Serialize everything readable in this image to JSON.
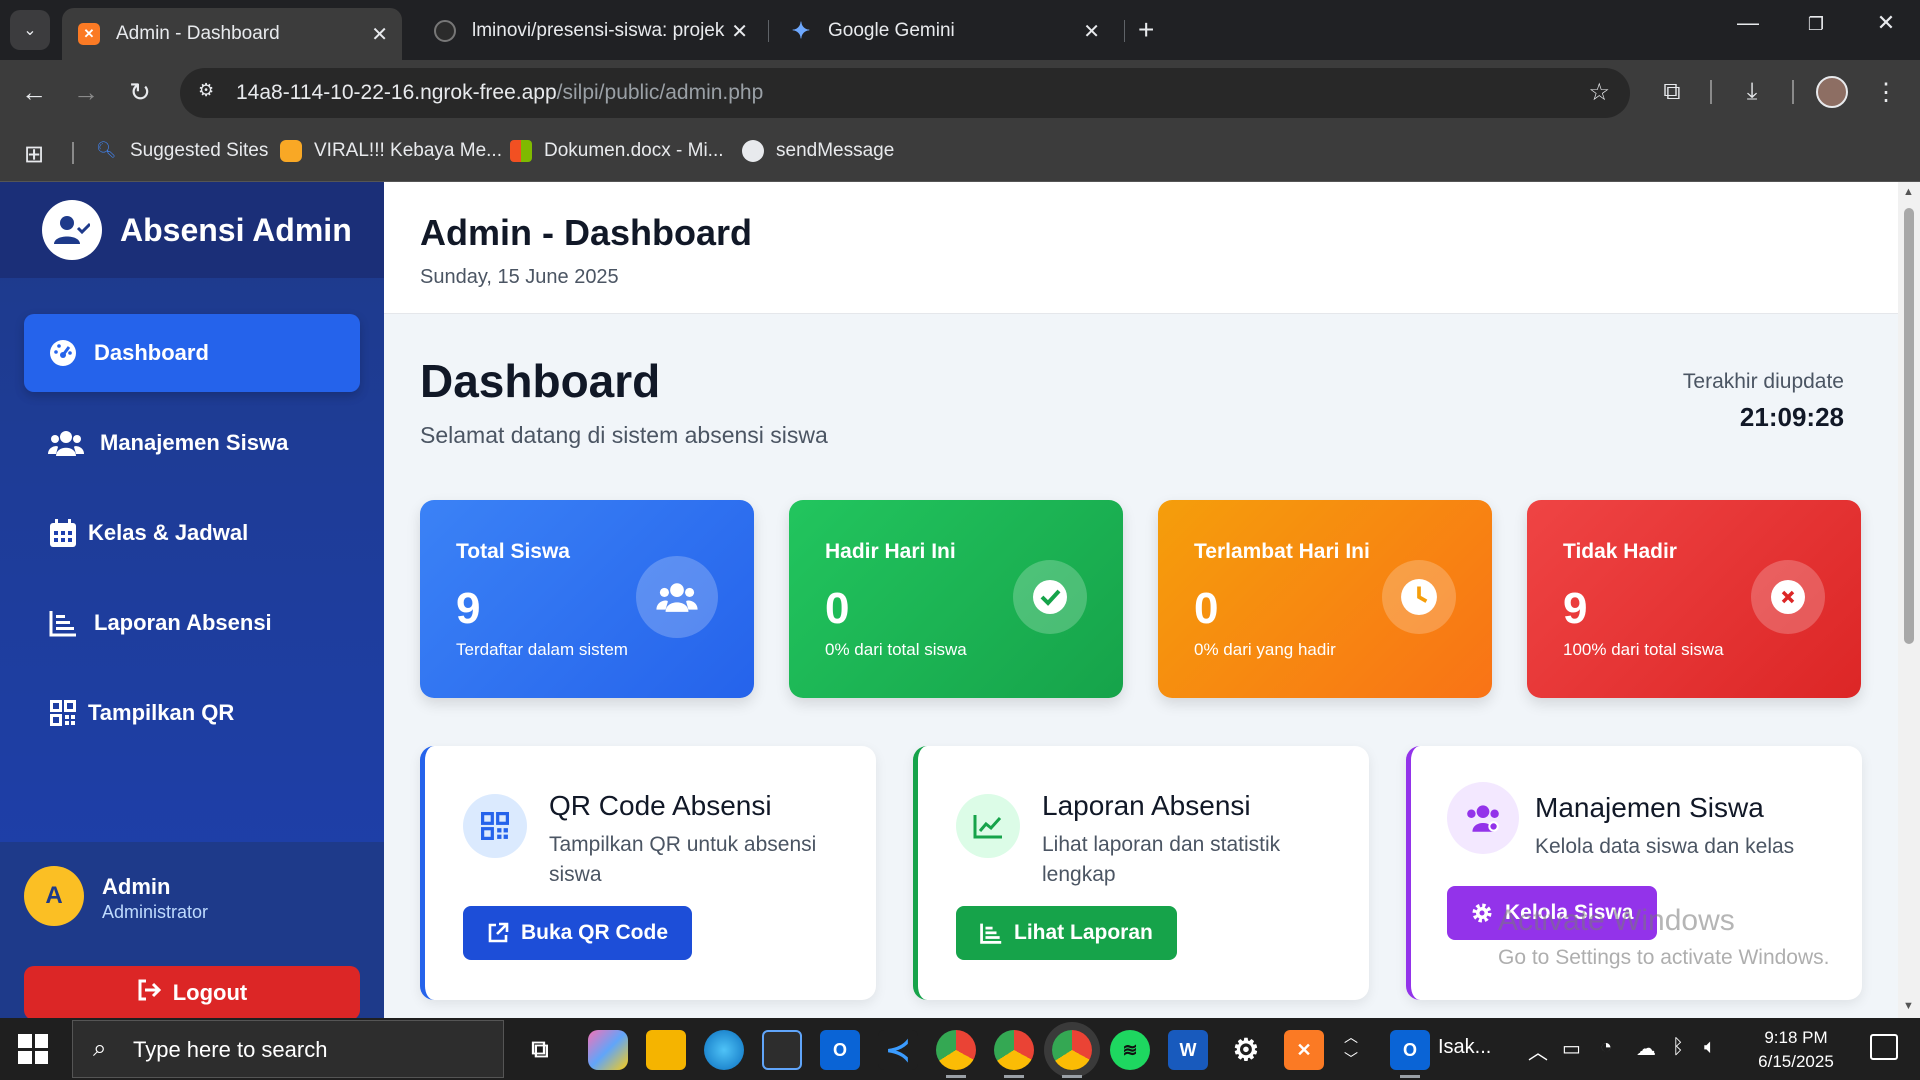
{
  "browser": {
    "tabs": [
      {
        "title": "Admin - Dashboard",
        "active": true
      },
      {
        "title": "lminovi/presensi-siswa: projek p",
        "active": false
      },
      {
        "title": "Google Gemini",
        "active": false
      }
    ],
    "url_host": "14a8-114-10-22-16.ngrok-free.app",
    "url_path": "/silpi/public/admin.php",
    "bookmarks": [
      "Suggested Sites",
      "VIRAL!!! Kebaya Me...",
      "Dokumen.docx - Mi...",
      "sendMessage"
    ]
  },
  "sidebar": {
    "brand": "Absensi Admin",
    "items": [
      {
        "label": "Dashboard",
        "icon": "gauge-icon",
        "active": true
      },
      {
        "label": "Manajemen Siswa",
        "icon": "users-icon",
        "active": false
      },
      {
        "label": "Kelas & Jadwal",
        "icon": "calendar-icon",
        "active": false
      },
      {
        "label": "Laporan Absensi",
        "icon": "chart-icon",
        "active": false
      },
      {
        "label": "Tampilkan QR",
        "icon": "qr-icon",
        "active": false
      }
    ],
    "user": {
      "initial": "A",
      "name": "Admin",
      "role": "Administrator"
    },
    "logout_label": "Logout"
  },
  "header": {
    "title": "Admin - Dashboard",
    "date": "Sunday, 15 June 2025"
  },
  "dashboard": {
    "title": "Dashboard",
    "subtitle": "Selamat datang di sistem absensi siswa",
    "updated_label": "Terakhir diupdate",
    "updated_time": "21:09:28"
  },
  "stats": [
    {
      "label": "Total Siswa",
      "value": "9",
      "note": "Terdaftar dalam sistem",
      "icon": "users-icon",
      "color": "#3b82f6"
    },
    {
      "label": "Hadir Hari Ini",
      "value": "0",
      "note": "0% dari total siswa",
      "icon": "check-circle-icon",
      "color": "#22c55e"
    },
    {
      "label": "Terlambat Hari Ini",
      "value": "0",
      "note": "0% dari yang hadir",
      "icon": "clock-icon",
      "color": "#f59e0b"
    },
    {
      "label": "Tidak Hadir",
      "value": "9",
      "note": "100% dari total siswa",
      "icon": "x-circle-icon",
      "color": "#ef4444"
    }
  ],
  "cards": [
    {
      "title": "QR Code Absensi",
      "desc": "Tampilkan QR untuk absensi siswa",
      "button": "Buka QR Code",
      "icon": "qr-icon",
      "accent": "#2563eb"
    },
    {
      "title": "Laporan Absensi",
      "desc": "Lihat laporan dan statistik lengkap",
      "button": "Lihat Laporan",
      "icon": "chart-line-icon",
      "accent": "#16a34a"
    },
    {
      "title": "Manajemen Siswa",
      "desc": "Kelola data siswa dan kelas",
      "button": "Kelola Siswa",
      "icon": "users-cog-icon",
      "accent": "#9333ea"
    }
  ],
  "watermark": {
    "line1": "Activate Windows",
    "line2": "Go to Settings to activate Windows."
  },
  "taskbar": {
    "search_placeholder": "Type here to search",
    "task_label": "Isak...",
    "time": "9:18 PM",
    "date": "6/15/2025"
  }
}
